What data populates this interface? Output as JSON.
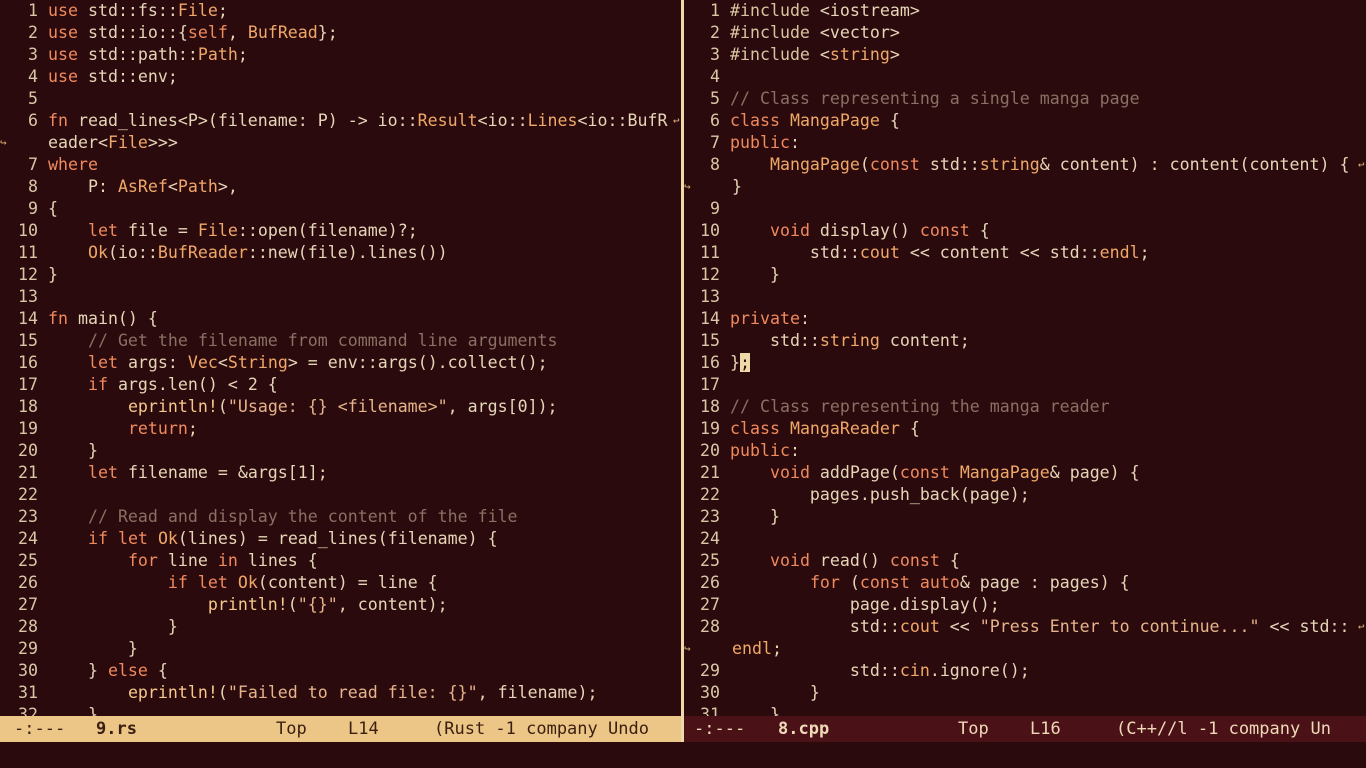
{
  "left": {
    "lines": [
      {
        "n": "1",
        "t": "use std::fs::File;"
      },
      {
        "n": "2",
        "t": "use std::io::{self, BufRead};"
      },
      {
        "n": "3",
        "t": "use std::path::Path;"
      },
      {
        "n": "4",
        "t": "use std::env;"
      },
      {
        "n": "5",
        "t": ""
      },
      {
        "n": "6",
        "t": "fn read_lines<P>(filename: P) -> io::Result<io::Lines<io::BufR"
      },
      {
        "n": "",
        "t": "eader<File>>>"
      },
      {
        "n": "7",
        "t": "where"
      },
      {
        "n": "8",
        "t": "    P: AsRef<Path>,"
      },
      {
        "n": "9",
        "t": "{"
      },
      {
        "n": "10",
        "t": "    let file = File::open(filename)?;"
      },
      {
        "n": "11",
        "t": "    Ok(io::BufReader::new(file).lines())"
      },
      {
        "n": "12",
        "t": "}"
      },
      {
        "n": "13",
        "t": ""
      },
      {
        "n": "14",
        "t": "fn main() {"
      },
      {
        "n": "15",
        "t": "    // Get the filename from command line arguments"
      },
      {
        "n": "16",
        "t": "    let args: Vec<String> = env::args().collect();"
      },
      {
        "n": "17",
        "t": "    if args.len() < 2 {"
      },
      {
        "n": "18",
        "t": "        eprintln!(\"Usage: {} <filename>\", args[0]);"
      },
      {
        "n": "19",
        "t": "        return;"
      },
      {
        "n": "20",
        "t": "    }"
      },
      {
        "n": "21",
        "t": "    let filename = &args[1];"
      },
      {
        "n": "22",
        "t": ""
      },
      {
        "n": "23",
        "t": "    // Read and display the content of the file"
      },
      {
        "n": "24",
        "t": "    if let Ok(lines) = read_lines(filename) {"
      },
      {
        "n": "25",
        "t": "        for line in lines {"
      },
      {
        "n": "26",
        "t": "            if let Ok(content) = line {"
      },
      {
        "n": "27",
        "t": "                println!(\"{}\", content);"
      },
      {
        "n": "28",
        "t": "            }"
      },
      {
        "n": "29",
        "t": "        }"
      },
      {
        "n": "30",
        "t": "    } else {"
      },
      {
        "n": "31",
        "t": "        eprintln!(\"Failed to read file: {}\", filename);"
      },
      {
        "n": "32",
        "t": "    }"
      }
    ]
  },
  "right": {
    "lines": [
      {
        "n": "1",
        "t": "#include <iostream>"
      },
      {
        "n": "2",
        "t": "#include <vector>"
      },
      {
        "n": "3",
        "t": "#include <string>"
      },
      {
        "n": "4",
        "t": ""
      },
      {
        "n": "5",
        "t": "// Class representing a single manga page"
      },
      {
        "n": "6",
        "t": "class MangaPage {"
      },
      {
        "n": "7",
        "t": "public:"
      },
      {
        "n": "8",
        "t": "    MangaPage(const std::string& content) : content(content) {"
      },
      {
        "n": "",
        "t": "}"
      },
      {
        "n": "9",
        "t": ""
      },
      {
        "n": "10",
        "t": "    void display() const {"
      },
      {
        "n": "11",
        "t": "        std::cout << content << std::endl;"
      },
      {
        "n": "12",
        "t": "    }"
      },
      {
        "n": "13",
        "t": ""
      },
      {
        "n": "14",
        "t": "private:"
      },
      {
        "n": "15",
        "t": "    std::string content;"
      },
      {
        "n": "16",
        "t": "};"
      },
      {
        "n": "17",
        "t": ""
      },
      {
        "n": "18",
        "t": "// Class representing the manga reader"
      },
      {
        "n": "19",
        "t": "class MangaReader {"
      },
      {
        "n": "20",
        "t": "public:"
      },
      {
        "n": "21",
        "t": "    void addPage(const MangaPage& page) {"
      },
      {
        "n": "22",
        "t": "        pages.push_back(page);"
      },
      {
        "n": "23",
        "t": "    }"
      },
      {
        "n": "24",
        "t": ""
      },
      {
        "n": "25",
        "t": "    void read() const {"
      },
      {
        "n": "26",
        "t": "        for (const auto& page : pages) {"
      },
      {
        "n": "27",
        "t": "            page.display();"
      },
      {
        "n": "28",
        "t": "            std::cout << \"Press Enter to continue...\" << std::"
      },
      {
        "n": "",
        "t": "endl;"
      },
      {
        "n": "29",
        "t": "            std::cin.ignore();"
      },
      {
        "n": "30",
        "t": "        }"
      },
      {
        "n": "31",
        "t": "    }"
      }
    ]
  },
  "modeline_left": {
    "status": "-:---",
    "buffer": "9.rs",
    "position": "Top",
    "line": "L14",
    "modes": "(Rust -1 company Undo"
  },
  "modeline_right": {
    "status": "-:---",
    "buffer": "8.cpp",
    "position": "Top",
    "line": "L16",
    "modes": "(C++//l -1 company Un"
  },
  "colors": {
    "background": "#2b0a0d",
    "modeline_active": "#ebc686",
    "modeline_inactive": "#4a1217",
    "keyword": "#f08a5d",
    "comment": "#8a6f63"
  }
}
